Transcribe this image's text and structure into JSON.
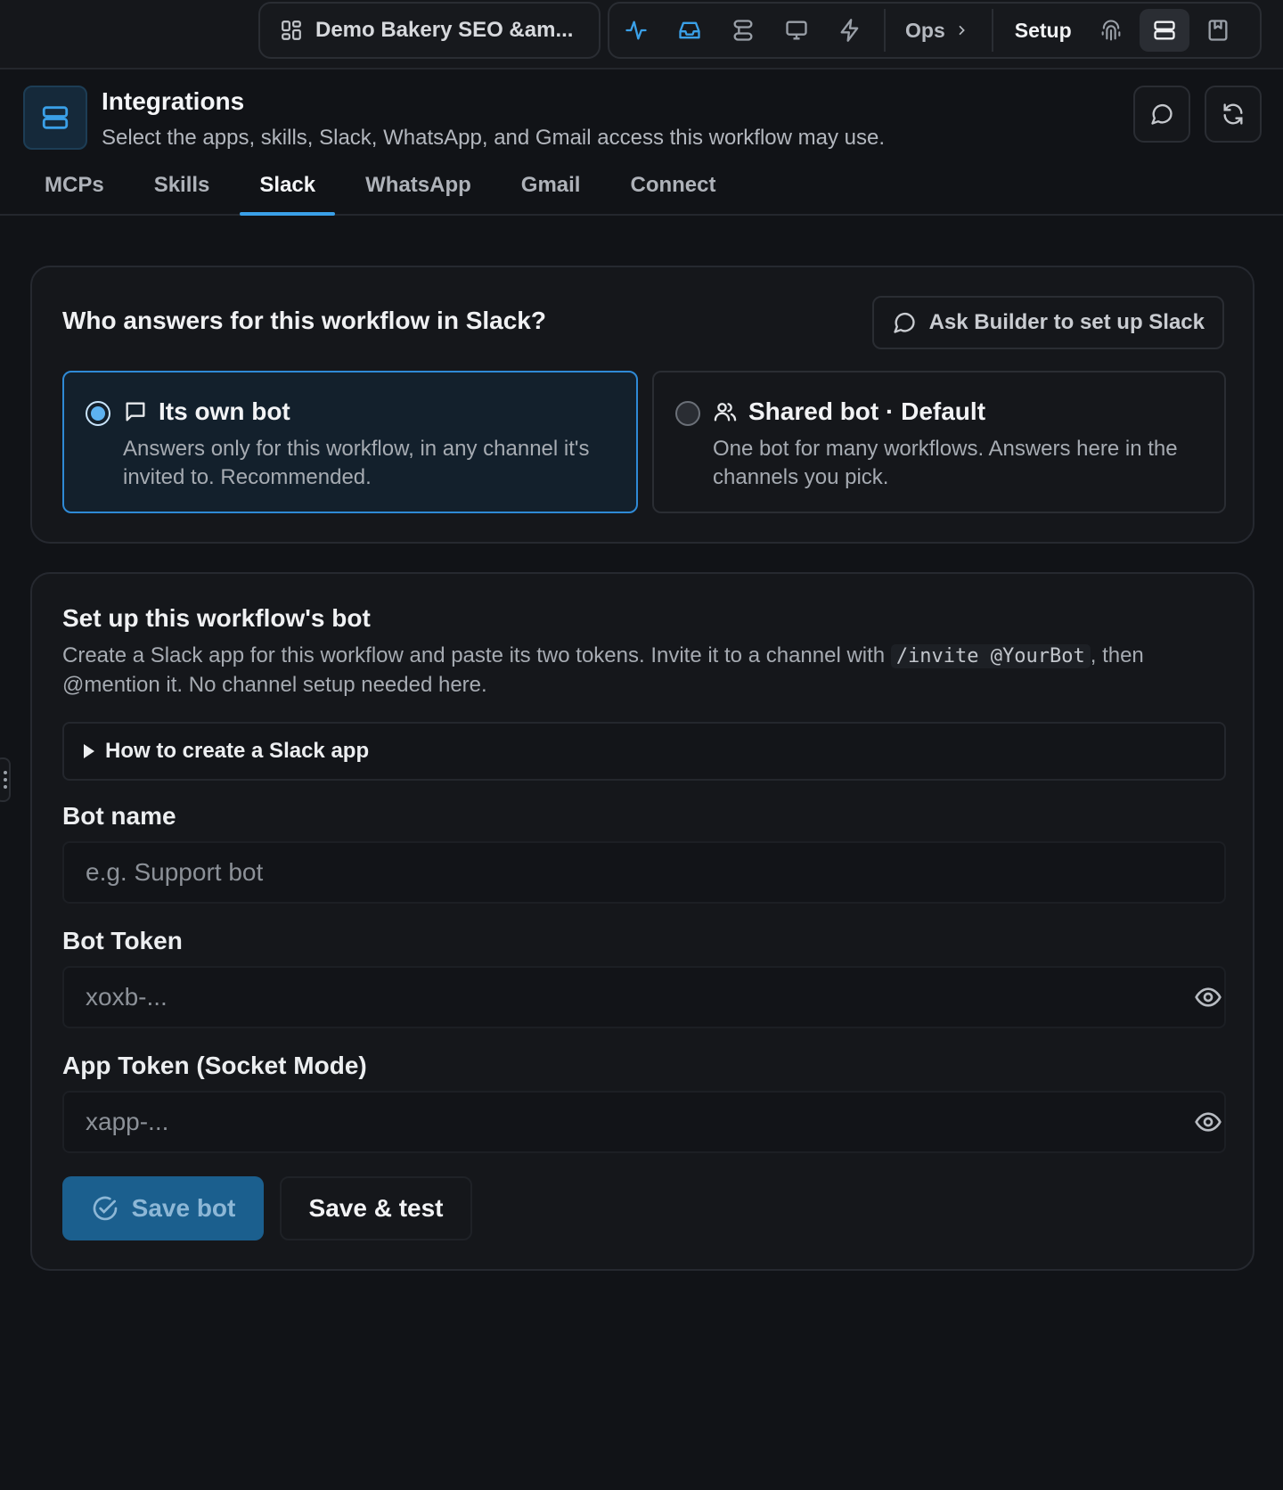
{
  "topbar": {
    "workspace_label": "Demo Bakery SEO &am...",
    "ops_label": "Ops",
    "setup_label": "Setup"
  },
  "header": {
    "title": "Integrations",
    "subtitle": "Select the apps, skills, Slack, WhatsApp, and Gmail access this workflow may use.",
    "tabs": [
      "MCPs",
      "Skills",
      "Slack",
      "WhatsApp",
      "Gmail",
      "Connect"
    ],
    "active_tab": "Slack"
  },
  "responder": {
    "title": "Who answers for this workflow in Slack?",
    "ask_button": "Ask Builder to set up Slack",
    "options": [
      {
        "title": "Its own bot",
        "description": "Answers only for this workflow, in any channel it's invited to. Recommended.",
        "selected": true
      },
      {
        "title": "Shared bot · Default",
        "description": "One bot for many workflows. Answers here in the channels you pick.",
        "selected": false
      }
    ]
  },
  "setup": {
    "title": "Set up this workflow's bot",
    "desc_before": "Create a Slack app for this workflow and paste its two tokens. Invite it to a channel with",
    "desc_code": "/invite @YourBot",
    "desc_after": ", then @mention it. No channel setup needed here.",
    "howto_label": "How to create a Slack app",
    "bot_name_label": "Bot name",
    "bot_name_placeholder": "e.g. Support bot",
    "bot_token_label": "Bot Token",
    "bot_token_placeholder": "xoxb-...",
    "app_token_label": "App Token (Socket Mode)",
    "app_token_placeholder": "xapp-...",
    "save_bot_label": "Save bot",
    "save_test_label": "Save & test"
  },
  "colors": {
    "accent": "#3aa0e8",
    "background": "#111317",
    "card": "#15171b",
    "save_button": "#1b5f8e"
  },
  "icons": {
    "workspace": "grid-icon",
    "nav": [
      "activity-icon",
      "inbox-icon",
      "workflow-icon",
      "monitor-icon",
      "bolt-icon",
      "fingerprint-icon",
      "server-icon",
      "bookmark-icon"
    ]
  }
}
